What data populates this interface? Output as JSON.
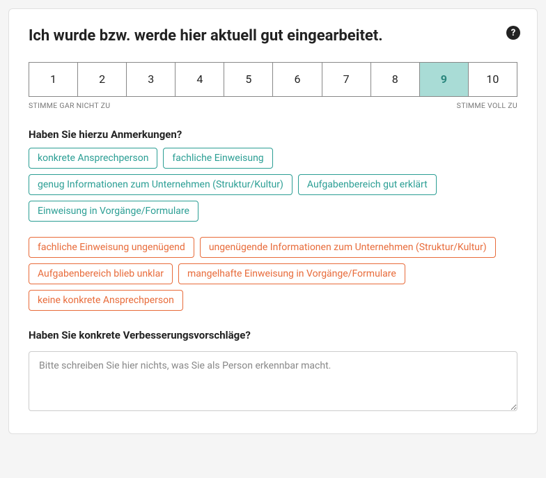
{
  "question": "Ich wurde bzw. werde hier aktuell gut eingearbeitet.",
  "help_icon_label": "?",
  "scale": {
    "values": [
      "1",
      "2",
      "3",
      "4",
      "5",
      "6",
      "7",
      "8",
      "9",
      "10"
    ],
    "selected_index": 8,
    "min_label": "STIMME GAR NICHT ZU",
    "max_label": "STIMME VOLL ZU"
  },
  "remarks_heading": "Haben Sie hierzu Anmerkungen?",
  "chips_positive": [
    "konkrete Ansprechperson",
    "fachliche Einweisung",
    "genug Informationen zum Unternehmen (Struktur/Kultur)",
    "Aufgabenbereich gut erklärt",
    "Einweisung in Vorgänge/Formulare"
  ],
  "chips_negative": [
    "fachliche Einweisung ungenügend",
    "ungenügende Informationen zum Unternehmen (Struktur/Kultur)",
    "Aufgabenbereich blieb unklar",
    "mangelhafte Einweisung in Vorgänge/Formulare",
    "keine konkrete Ansprechperson"
  ],
  "suggestions_heading": "Haben Sie konkrete Verbesserungsvorschläge?",
  "suggestions_placeholder": "Bitte schreiben Sie hier nichts, was Sie als Person erkennbar macht."
}
